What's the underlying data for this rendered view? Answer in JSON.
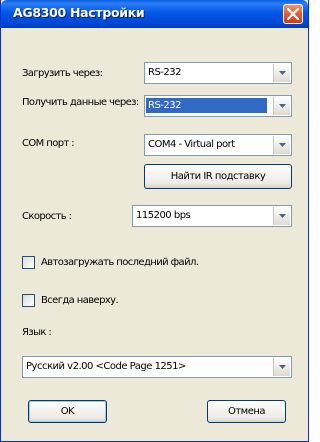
{
  "window": {
    "title": "AG8300 Настройки"
  },
  "form": {
    "load_via": {
      "label": "Загрузить через:",
      "value": "RS-232"
    },
    "receive_data": {
      "label": "Получить данные через:",
      "value": "RS-232"
    },
    "com_port": {
      "label": "COM порт :",
      "value": "COM4 - Virtual port"
    },
    "find_ir_button": "Найти IR подставку",
    "speed": {
      "label": "Скорость :",
      "value": "115200 bps"
    },
    "autoload_last_file": {
      "label": "Автозагружать последний файл.",
      "checked": false
    },
    "always_on_top": {
      "label": "Всегда наверху.",
      "checked": false
    },
    "language": {
      "label": "Язык :",
      "value": "Русский v2.00 <Code Page 1251>"
    }
  },
  "buttons": {
    "ok": "OK",
    "cancel": "Отмена"
  }
}
